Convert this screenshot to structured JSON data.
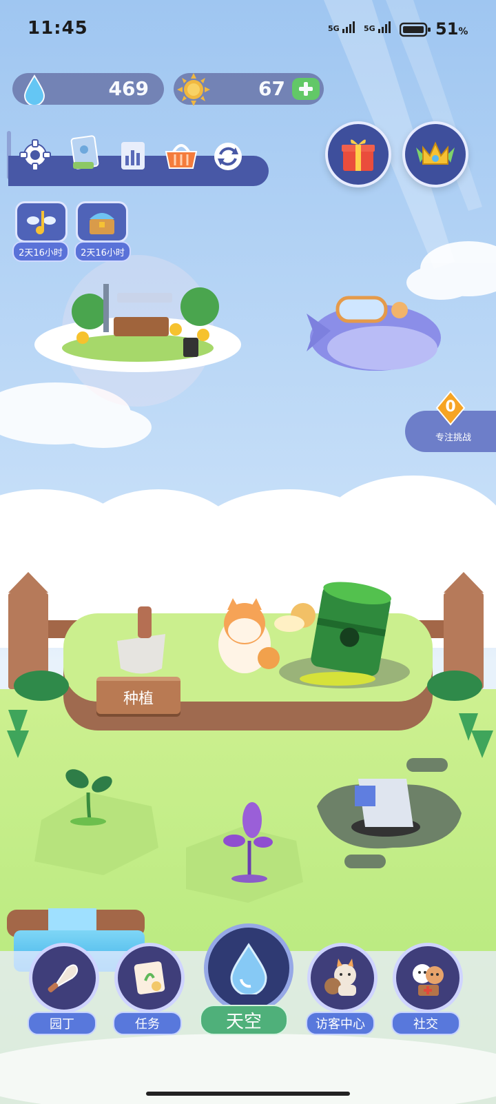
{
  "status_bar": {
    "time": "11:45",
    "signal1": "5G",
    "signal2": "5G",
    "battery": "51",
    "battery_unit": "%"
  },
  "resources": {
    "water": "469",
    "sun": "67"
  },
  "timers": [
    "2天16小时",
    "2天16小时"
  ],
  "garden": {
    "plant_sign": "种植"
  },
  "challenge": {
    "count": "0",
    "label": "专注挑战"
  },
  "bottom_nav": {
    "gardener": "园丁",
    "tasks": "任务",
    "sky": "天空",
    "visitor_center": "访客中心",
    "social": "社交"
  },
  "colors": {
    "sky_top": "#a9cdf3",
    "grass": "#bdec7c",
    "accent_blue": "#4858a6",
    "accent_green": "#4fb07a"
  }
}
